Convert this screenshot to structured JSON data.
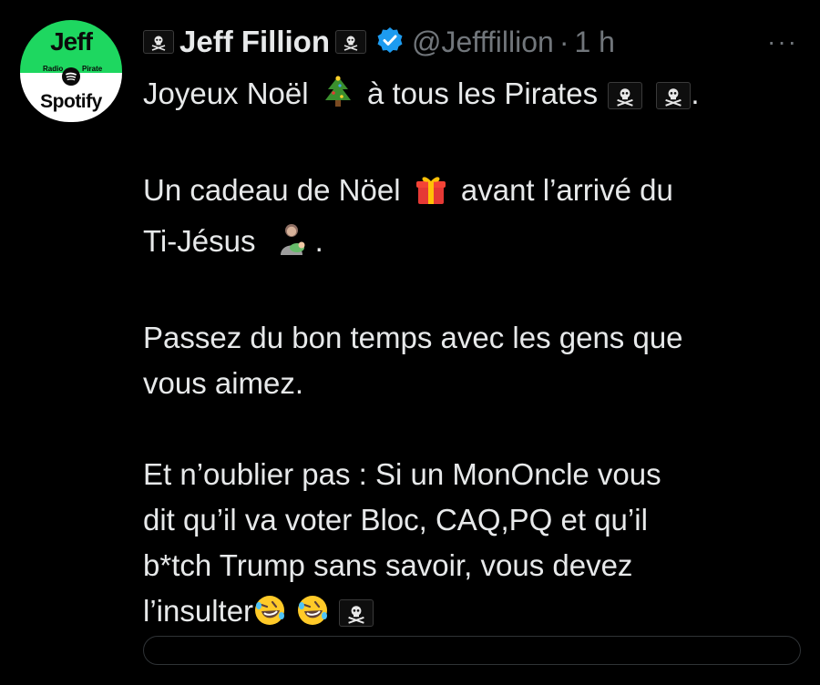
{
  "avatar": {
    "name": "Jeff",
    "sub_left": "Radio",
    "sub_right": "Pirate",
    "brand": "Spotify",
    "green": "#1ed760"
  },
  "header": {
    "display_name": "Jeff Fillion",
    "handle": "@Jefffillion",
    "separator": "·",
    "time": "1 h",
    "verified_color": "#1d9bf0",
    "flag_icon": "pirate-flag-icon",
    "more_label": "···"
  },
  "tweet": {
    "p1_a": "Joyeux Noël",
    "p1_b": "à tous les Pirates",
    "p1_c": ".",
    "p2_a": "Un cadeau de Nöel",
    "p2_b": "avant l’arrivé du",
    "p2_c": "Ti-Jésus",
    "p2_d": ".",
    "p3_a": "Passez du bon temps avec les gens que",
    "p3_b": "vous aimez.",
    "p4_a": "Et n’oublier pas : Si un MonOncle vous",
    "p4_b": "dit qu’il va voter Bloc, CAQ,PQ et qu’il",
    "p4_c": "b*tch Trump sans savoir, vous devez",
    "p4_d": "l’insulter"
  }
}
